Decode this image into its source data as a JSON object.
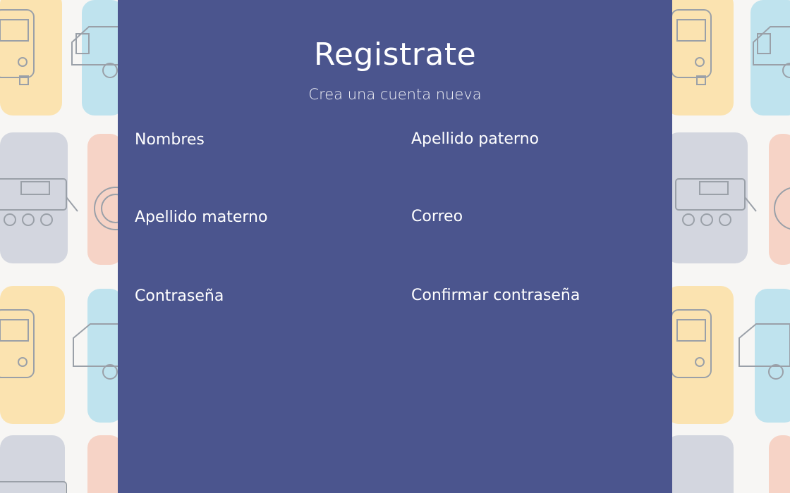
{
  "form": {
    "title": "Registrate",
    "subtitle": "Crea una cuenta nueva",
    "fields": [
      {
        "label": "Nombres",
        "value": ""
      },
      {
        "label": "Apellido paterno",
        "value": ""
      },
      {
        "label": "Apellido materno",
        "value": ""
      },
      {
        "label": "Correo",
        "value": ""
      },
      {
        "label": "Contraseña",
        "value": ""
      },
      {
        "label": "Confirmar contraseña",
        "value": ""
      }
    ]
  },
  "colors": {
    "panel": "#4b558e",
    "page_background": "#f7f6f4",
    "tile_yellow": "#fbe3b0",
    "tile_blue": "#bfe3ee",
    "tile_gray": "#d3d6df",
    "tile_pink": "#f6d3c6"
  },
  "background_icons": [
    "bus-icon",
    "van-icon",
    "train-icon",
    "wheel-icon"
  ]
}
